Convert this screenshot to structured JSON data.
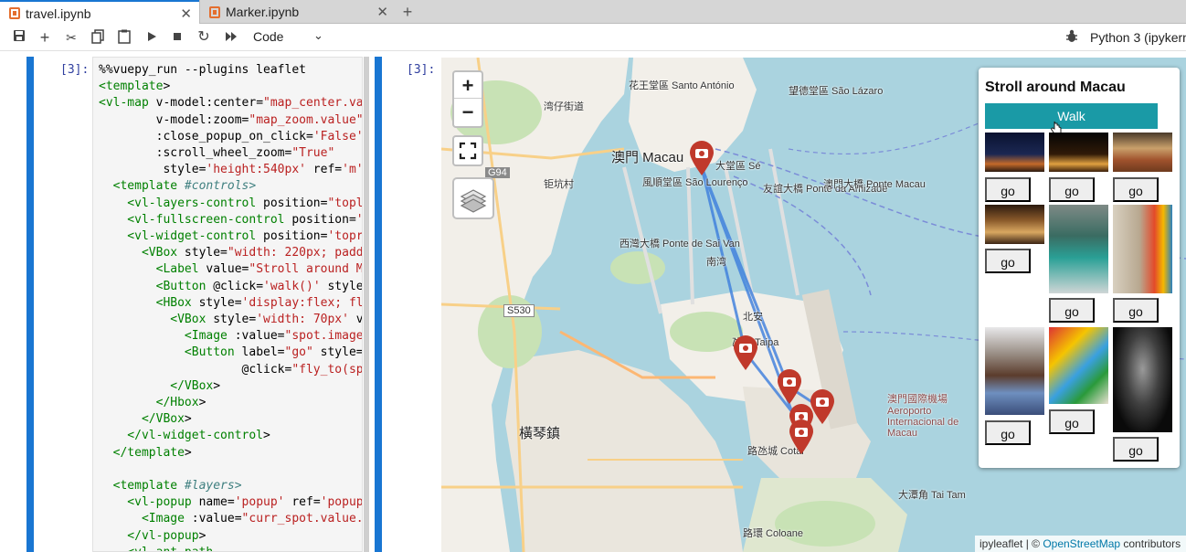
{
  "tabs": [
    {
      "label": "travel.ipynb",
      "close": "✕"
    },
    {
      "label": "Marker.ipynb",
      "close": "✕"
    }
  ],
  "tab_add": "+",
  "toolbar": {
    "cell_type": "Code",
    "kernel": "Python 3 (ipykern"
  },
  "cells": {
    "input_prompt": "[3]:",
    "output_prompt": "[3]:"
  },
  "code_lines": [
    "%%vuepy_run --plugins leaflet",
    "<template>",
    "<vl-map v-model:center=\"map_center.va",
    "        v-model:zoom=\"map_zoom.value\"",
    "        :close_popup_on_click='False'",
    "        :scroll_wheel_zoom=\"True\"",
    "         style='height:540px' ref='m'",
    "  <template #controls>",
    "    <vl-layers-control position=\"topl",
    "    <vl-fullscreen-control position='",
    "    <vl-widget-control position='topr",
    "      <VBox style=\"width: 220px; padd",
    "        <Label value=\"Stroll around M",
    "        <Button @click='walk()' style",
    "        <HBox style='display:flex; fl",
    "          <VBox style='width: 70px' v",
    "            <Image :value=\"spot.image",
    "            <Button label=\"go\" style=",
    "                    @click=\"fly_to(sp",
    "          </VBox>",
    "        </Hbox>",
    "      </VBox>",
    "    </vl-widget-control>",
    "  </template>",
    "",
    "  <template #layers>",
    "    <vl-popup name='popup' ref='popup",
    "      <Image :value=\"curr_spot.value.",
    "    </vl-popup>",
    "    <vl-ant-path"
  ],
  "map": {
    "labels": [
      "花王堂區 Santo António",
      "望德堂區 São Lázaro",
      "風順堂區 São Lourenço",
      "大堂區 Sé",
      "澳門 Macau",
      "友誼大橋 Ponte da Amizade",
      "西灣大橋 Ponte de Sai Van",
      "澳門大橋 Ponte Macau",
      "橫琴鎮",
      "氹仔 Taipa",
      "路氹城 Cotai",
      "大潭角 Tai Tam",
      "路環 Coloane",
      "澳門國際機場 Aeroporto Internacional de Macau",
      "湾仔街道",
      "钜坑村",
      "南湾",
      "北安",
      "G94",
      "S530"
    ]
  },
  "panel": {
    "title": "Stroll around Macau",
    "walk_label": "Walk",
    "go_label": "go"
  },
  "attribution": {
    "prefix": "ipyleaflet | © ",
    "link": "OpenStreetMap",
    "suffix": " contributors"
  },
  "colors": {
    "accent": "#1976d2",
    "walk_button": "#1a9aa6",
    "marker": "#c0392b",
    "water": "#aad3df",
    "land": "#f2efe9"
  }
}
